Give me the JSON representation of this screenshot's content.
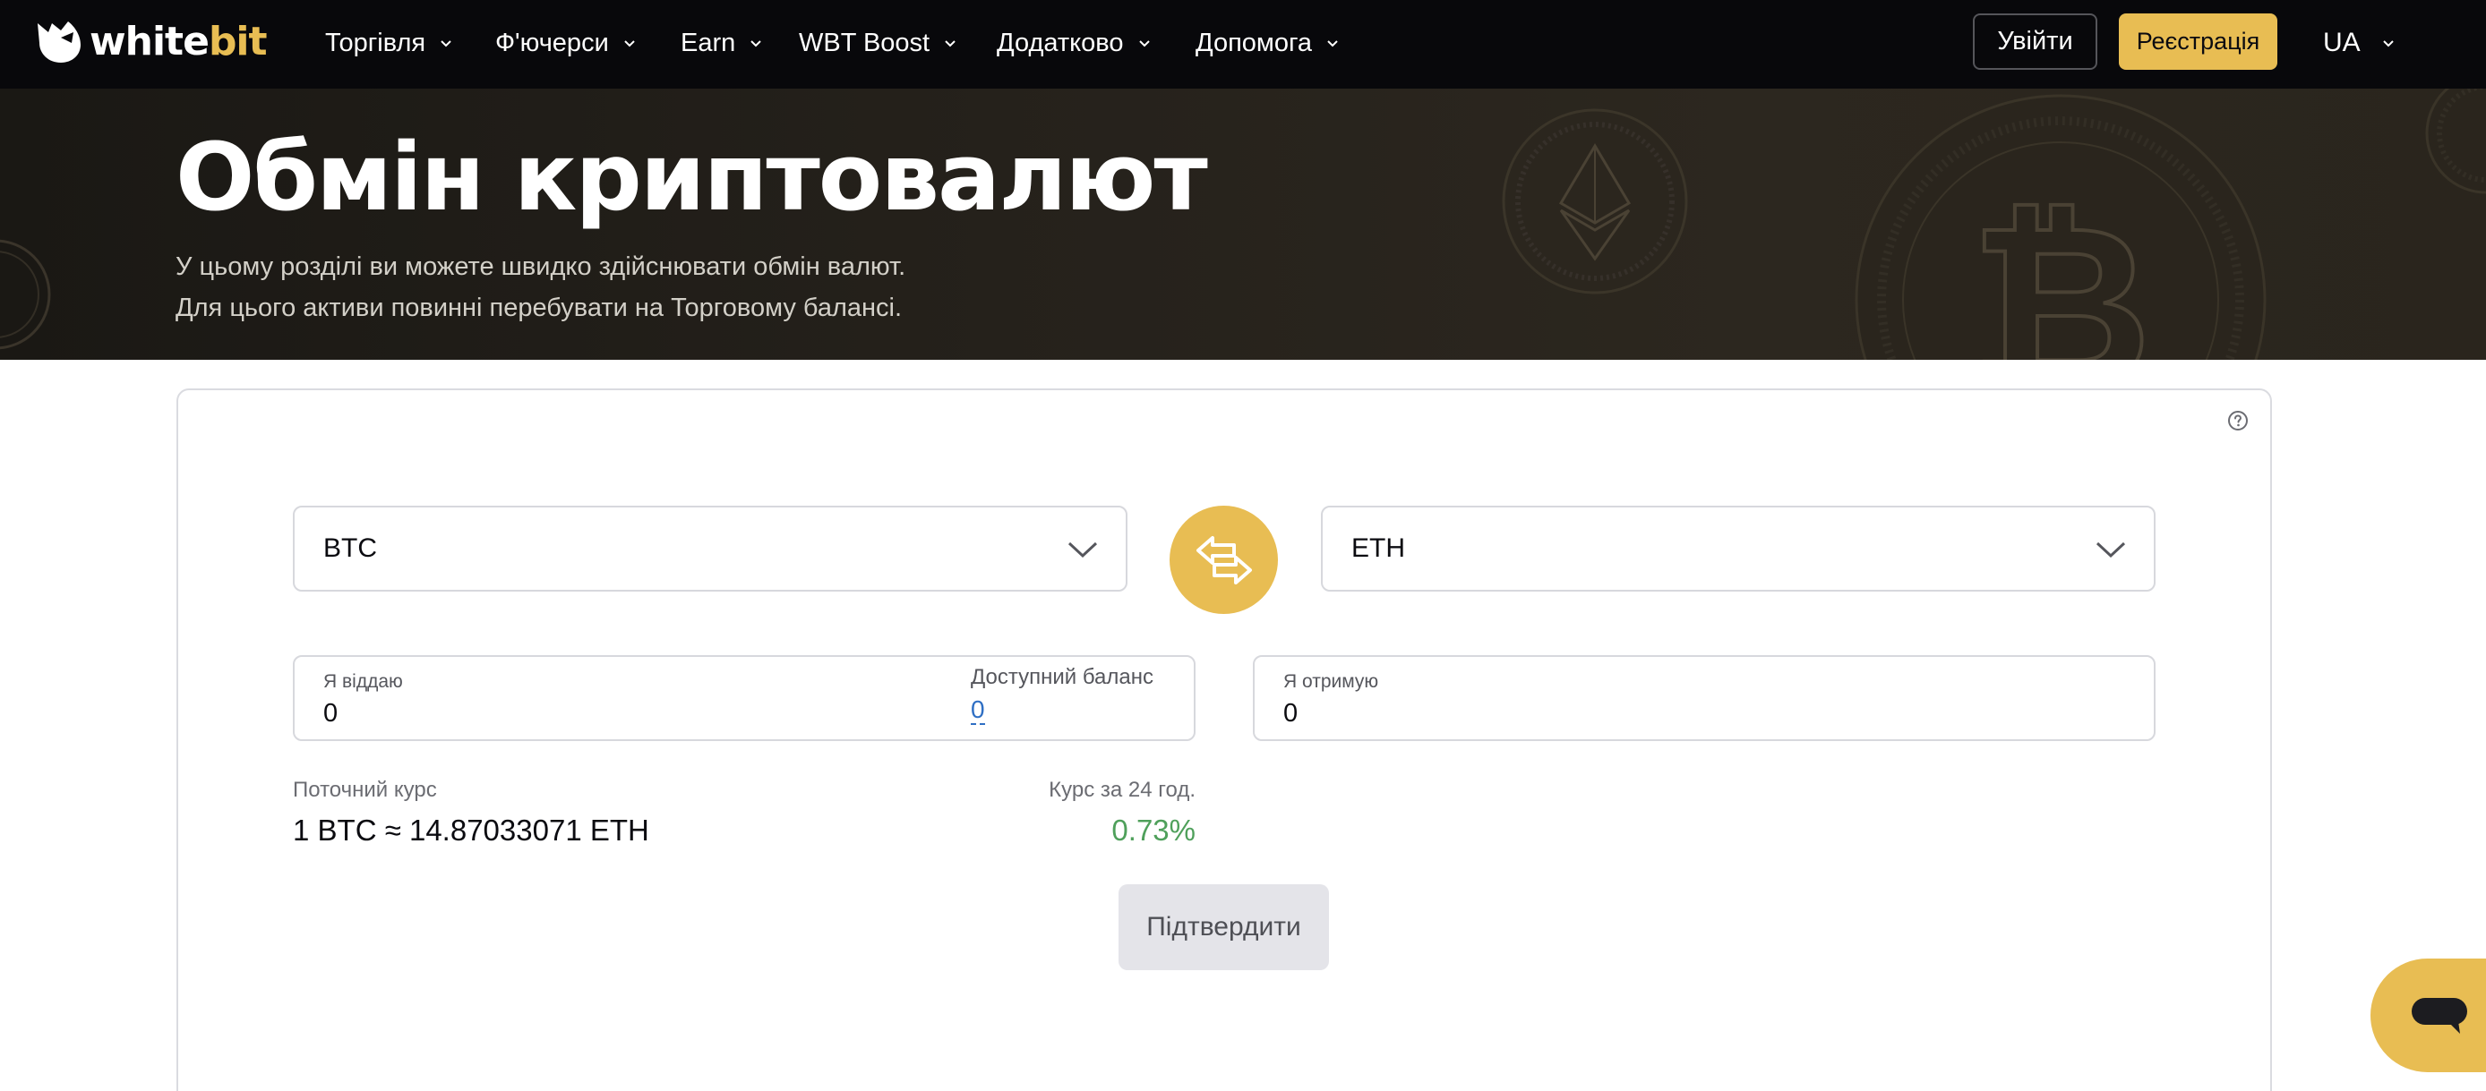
{
  "navbar": {
    "logo": {
      "part1": "white",
      "part2": "bit"
    },
    "items": [
      {
        "label": "Торгівля"
      },
      {
        "label": "Ф'ючерси"
      },
      {
        "label": "Earn"
      },
      {
        "label": "WBT Boost"
      },
      {
        "label": "Додатково"
      },
      {
        "label": "Допомога"
      }
    ],
    "login_label": "Увійти",
    "register_label": "Реєстрація",
    "language": "UA"
  },
  "hero": {
    "title": "Обмін криптовалют",
    "line1": "У цьому розділі ви можете швидко здійснювати обмін валют.",
    "line2": "Для цього активи повинні перебувати на Торговому балансі."
  },
  "exchange": {
    "from_currency": "BTC",
    "to_currency": "ETH",
    "give": {
      "label": "Я віддаю",
      "value": "0"
    },
    "balance": {
      "label": "Доступний баланс",
      "value": "0"
    },
    "receive": {
      "label": "Я отримую",
      "value": "0"
    },
    "rate": {
      "label": "Поточний курс",
      "value": "1 BTC ≈ 14.87033071 ETH"
    },
    "rate24": {
      "label": "Курс за 24 год.",
      "value": "0.73%"
    },
    "confirm_label": "Підтвердити"
  },
  "colors": {
    "accent": "#e8bd53",
    "navbar_bg": "#08080b",
    "positive": "#4fa05b",
    "link": "#2f6fc4"
  }
}
